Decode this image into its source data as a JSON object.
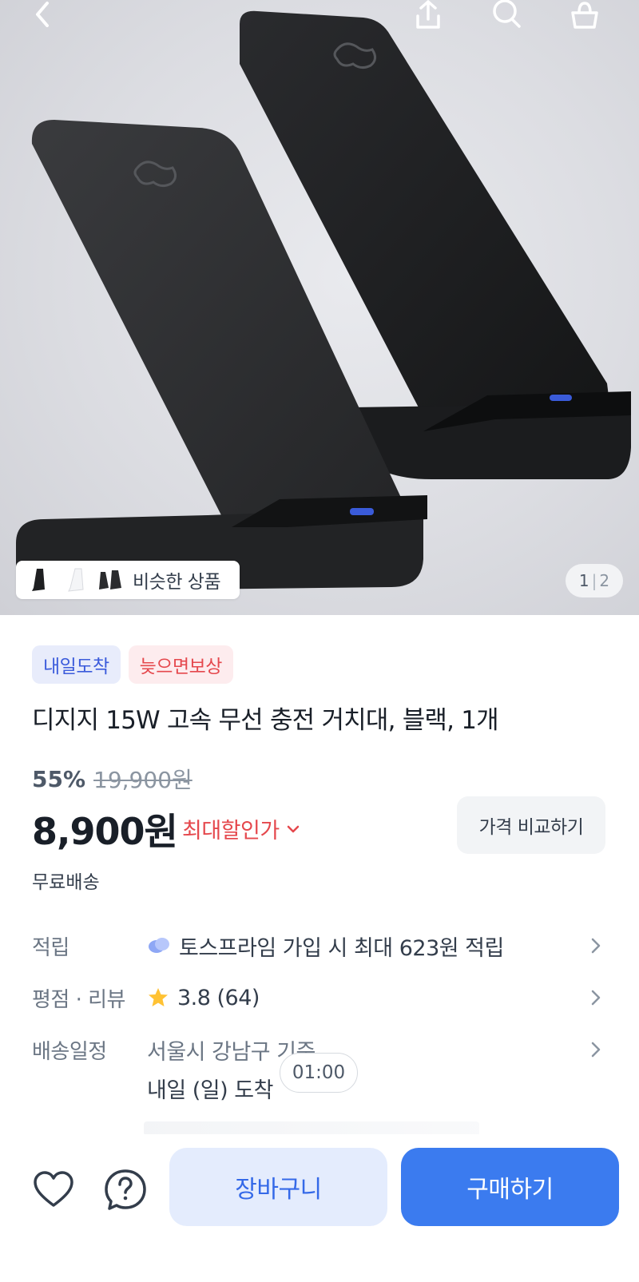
{
  "header": {
    "back_icon": "back-arrow-icon",
    "share_icon": "share-icon",
    "search_icon": "search-icon",
    "cart_icon": "shopping-bag-icon"
  },
  "gallery": {
    "similar_label": "비슷한 상품",
    "page_current": "1",
    "page_separator": "|",
    "page_total": "2"
  },
  "product": {
    "badges": [
      "내일도착",
      "늦으면보상"
    ],
    "title": "디지지 15W 고속 무선 충전 거치대, 블랙, 1개",
    "discount_rate": "55%",
    "original_price": "19,900원",
    "price": "8,900원",
    "max_discount_label": "최대할인가",
    "compare_button": "가격 비교하기",
    "shipping": "무료배송"
  },
  "info": {
    "points_label": "적립",
    "points_value": "토스프라임 가입 시 최대 623원 적립",
    "rating_label": "평점 · 리뷰",
    "rating_value": "3.8 (64)",
    "delivery_label": "배송일정",
    "delivery_location": "서울시 강남구 기준",
    "delivery_eta": "내일 (일) 도착",
    "countdown": "01:00"
  },
  "actions": {
    "wishlist_icon": "heart-icon",
    "inquiry_icon": "question-icon",
    "cart_button": "장바구니",
    "buy_button": "구매하기"
  },
  "colors": {
    "primary": "#3b7bef",
    "primary_light": "#e4ecfd",
    "sale_red": "#e5484d",
    "badge_blue": "#3b5bdb"
  }
}
